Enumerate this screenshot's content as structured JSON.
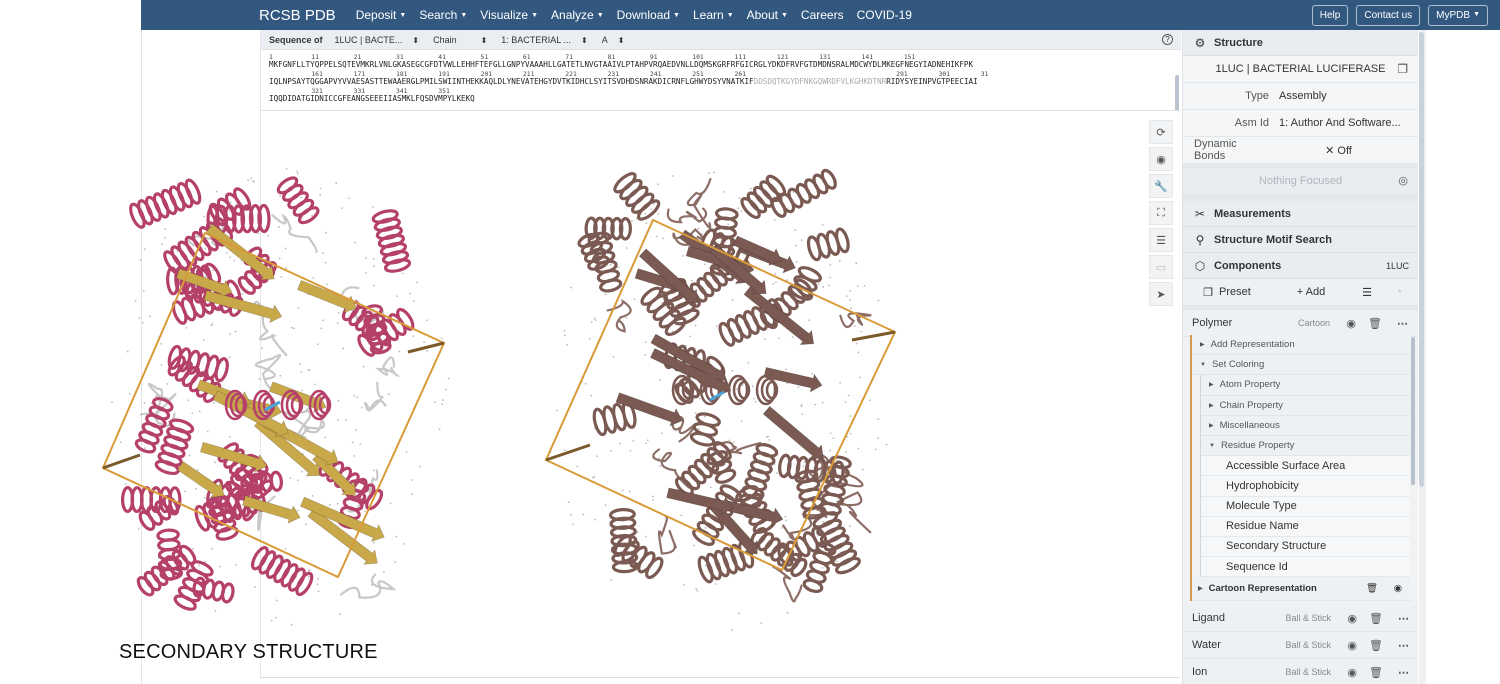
{
  "nav": {
    "brand": "RCSB PDB",
    "items": [
      {
        "label": "Deposit",
        "caret": true
      },
      {
        "label": "Search",
        "caret": true
      },
      {
        "label": "Visualize",
        "caret": true
      },
      {
        "label": "Analyze",
        "caret": true
      },
      {
        "label": "Download",
        "caret": true
      },
      {
        "label": "Learn",
        "caret": true
      },
      {
        "label": "About",
        "caret": true
      },
      {
        "label": "Careers",
        "caret": false
      },
      {
        "label": "COVID-19",
        "caret": false
      }
    ],
    "help": "Help",
    "contact": "Contact us",
    "mypdb": "MyPDB"
  },
  "sequence_bar": {
    "label": "Sequence of",
    "entity": "1LUC | BACTE...",
    "mode": "Chain",
    "chain_name": "1: BACTERIAL ...",
    "chain_id": "A"
  },
  "sequence": {
    "numbers": [
      "1          11         21         31         41         51         61         71         81         91         101        111        121        131        141        151",
      "           161        171        181        191        201        211        221        231        241        251        261                                       291        301        31",
      "           321        331        341        351"
    ],
    "line1": "MKFGNFLLTYQPPELSQTEVMKRLVNLGKASEGCGFDTVWLLEHHFTEFGLLGNPYVAAAHLLGATETLNVGTAAIVLPTAHPVRQAEDVNLLDQMSKGRFRFGICRGLYDKDFRVFGTDMDNSRALMDCWYDLMKEGFNEGYIADNEHIKFPK",
    "line2_main": "IQLNPSAYTQGGAPVYVVAESASTTEWAAERGLPMILSWIINTHEKKAQLDLYNEVATEHGYDVTKIDHCLSYITSVDHDSNRAKDICRNFLGHWYDSYVNATKIF",
    "line2_dim": "DDSDQTKGYDFNKGQWRDFVLKGHKDTNR",
    "line2_tail": "RIDYSYEINPVGTPEECIAI",
    "line3": "IQQDIDATGIDNICCGFEANGSEEEIIASMKLFQSDVMPYLKEKQ"
  },
  "viewer_tools": [
    {
      "name": "reset-icon",
      "glyph": "⟳"
    },
    {
      "name": "focus-icon",
      "glyph": "◉"
    },
    {
      "name": "wrench-icon",
      "glyph": "🔧"
    },
    {
      "name": "expand-icon",
      "glyph": "⛶"
    },
    {
      "name": "settings-icon",
      "glyph": "☰"
    },
    {
      "name": "vr-icon",
      "glyph": "▭"
    },
    {
      "name": "pointer-icon",
      "glyph": "➤"
    }
  ],
  "caption": "SECONDARY STRUCTURE",
  "panel": {
    "structure_header": "Structure",
    "structure_name": "1LUC | BACTERIAL LUCIFERASE",
    "type_key": "Type",
    "type_val": "Assembly",
    "asm_key": "Asm Id",
    "asm_val": "1: Author And Software...",
    "bonds_key": "Dynamic Bonds",
    "bonds_val": "✕  Off",
    "focus": "Nothing Focused",
    "measurements": "Measurements",
    "motif": "Structure Motif Search",
    "components": "Components",
    "components_id": "1LUC",
    "preset": "Preset",
    "add": "+  Add",
    "polymer": "Polymer",
    "polymer_type": "Cartoon",
    "tree": {
      "add_rep": "Add Representation",
      "set_coloring": "Set Coloring",
      "atom": "Atom Property",
      "chain": "Chain Property",
      "misc": "Miscellaneous",
      "residue": "Residue Property",
      "leaves": [
        "Accessible Surface Area",
        "Hydrophobicity",
        "Molecule Type",
        "Residue Name",
        "Secondary Structure",
        "Sequence Id"
      ],
      "cartoon": "Cartoon Representation"
    },
    "ligand": "Ligand",
    "ligand_type": "Ball & Stick",
    "water": "Water",
    "water_type": "Ball & Stick",
    "ion": "Ion",
    "ion_type": "Ball & Stick"
  },
  "colors": {
    "navbar": "#325880",
    "helix_pink": "#b5406a",
    "sheet_gold": "#c9a84a",
    "protein_brown": "#7a5a52",
    "box_orange": "#d99a38"
  }
}
